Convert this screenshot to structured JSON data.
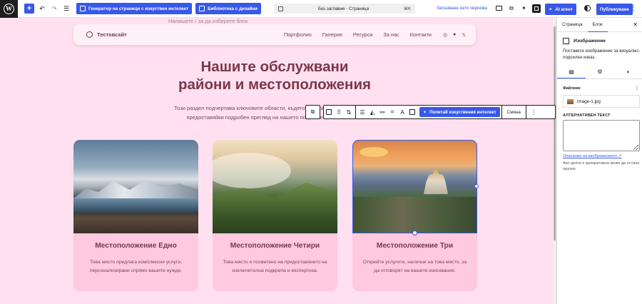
{
  "toolbar": {
    "ai_page_generator": "Генератор на страници с изкуствен интелект",
    "design_library": "Библиотека с дизайни",
    "doc_title": "Без заглавие · Страница",
    "shortcut": "⌘K",
    "save_draft": "Запазване като чернова",
    "ai_agent": "AI агент",
    "publish": "Публикуване"
  },
  "canvas": {
    "hint": "Напишете / за да изберете блок",
    "site_name": "Тестовсайт",
    "nav": [
      "Портфолио",
      "Галерия",
      "Ресурси",
      "За нас",
      "Контакти"
    ],
    "headline_1": "Нашите обслужвани",
    "headline_2": "райони и местоположения",
    "lead": "Този раздел подчертава ключовите области, където предлагаме нашите услуги, предоставяйки подробен преглед на нашето покритие и възможности.",
    "cards": [
      {
        "title": "Местоположение Едно",
        "text": "Това място предлага комплексни услуги, персонализирани спрямо вашите нужди."
      },
      {
        "title": "Местоположение Четири",
        "text": "Това място е посветено на предоставянето на изключителна подкрепа и експертиза."
      },
      {
        "title": "Местоположение Три",
        "text": "Открийте услугите, налични на това място, за да отговорят на вашите изисквания."
      }
    ]
  },
  "block_toolbar": {
    "ask_ai": "Попитай изкуствения интелект",
    "replace": "Смяна"
  },
  "sidebar": {
    "tab_page": "Страница",
    "tab_block": "Блок",
    "block_name": "Изображение",
    "block_desc": "Поставете изображение за визуално-подсилен изказ.",
    "files_label": "Файлове",
    "file_name": "image-1.jpg",
    "alt_label": "АЛТЕРНАТИВЕН ТЕКСТ",
    "alt_link": "Описание на изображението",
    "alt_help": "Ако целта е декоративна може да остане празно"
  },
  "colors": {
    "accent": "#3858e9",
    "canvas_bg": "#ffe0f1",
    "card_bg": "#ffc9e0",
    "heading": "#7a3848"
  }
}
